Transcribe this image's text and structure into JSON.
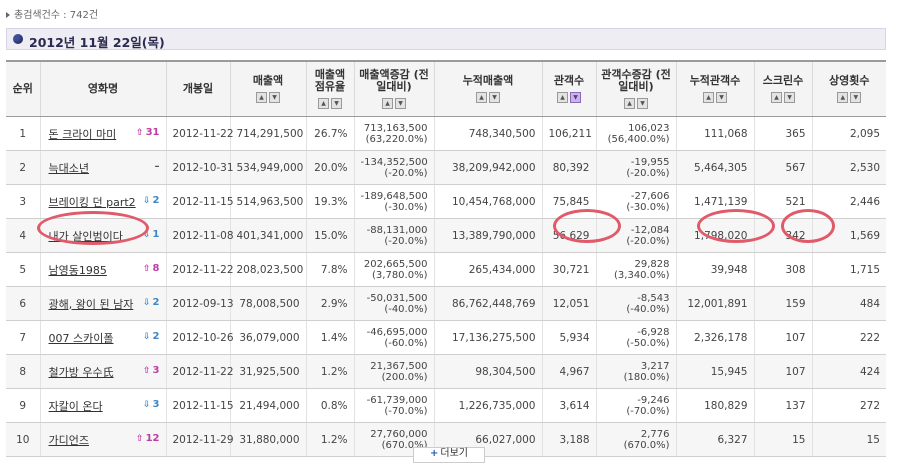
{
  "summary": {
    "total_label": "총검색건수 : 742건"
  },
  "date": {
    "title": "2012년 11월 22일(목)"
  },
  "columns": [
    "순위",
    "영화명",
    "개봉일",
    "매출액",
    "매출액 점유율",
    "매출액증감 (전일대비)",
    "누적매출액",
    "관객수",
    "관객수증감 (전일대비)",
    "누적관객수",
    "스크린수",
    "상영횟수"
  ],
  "rows": [
    {
      "rank": "1",
      "title": "돈 크라이 마미",
      "change": "31",
      "dir": "up",
      "release": "2012-11-22",
      "sales": "714,291,500",
      "share": "26.7%",
      "sales_delta": "713,163,500",
      "sales_delta_pct": "(63,220.0%)",
      "cum_sales": "748,340,500",
      "audience": "106,211",
      "aud_delta": "106,023",
      "aud_delta_pct": "(56,400.0%)",
      "cum_aud": "111,068",
      "screens": "365",
      "shows": "2,095"
    },
    {
      "rank": "2",
      "title": "늑대소년",
      "change": "–",
      "dir": "same",
      "release": "2012-10-31",
      "sales": "534,949,000",
      "share": "20.0%",
      "sales_delta": "-134,352,500",
      "sales_delta_pct": "(-20.0%)",
      "cum_sales": "38,209,942,000",
      "audience": "80,392",
      "aud_delta": "-19,955",
      "aud_delta_pct": "(-20.0%)",
      "cum_aud": "5,464,305",
      "screens": "567",
      "shows": "2,530"
    },
    {
      "rank": "3",
      "title": "브레이킹 던 part2",
      "change": "2",
      "dir": "down",
      "release": "2012-11-15",
      "sales": "514,963,500",
      "share": "19.3%",
      "sales_delta": "-189,648,500",
      "sales_delta_pct": "(-30.0%)",
      "cum_sales": "10,454,768,000",
      "audience": "75,845",
      "aud_delta": "-27,606",
      "aud_delta_pct": "(-30.0%)",
      "cum_aud": "1,471,139",
      "screens": "521",
      "shows": "2,446"
    },
    {
      "rank": "4",
      "title": "내가 살인범이다",
      "change": "1",
      "dir": "down",
      "release": "2012-11-08",
      "sales": "401,341,000",
      "share": "15.0%",
      "sales_delta": "-88,131,000",
      "sales_delta_pct": "(-20.0%)",
      "cum_sales": "13,389,790,000",
      "audience": "56,629",
      "aud_delta": "-12,084",
      "aud_delta_pct": "(-20.0%)",
      "cum_aud": "1,798,020",
      "screens": "342",
      "shows": "1,569"
    },
    {
      "rank": "5",
      "title": "남영동1985",
      "change": "8",
      "dir": "up",
      "release": "2012-11-22",
      "sales": "208,023,500",
      "share": "7.8%",
      "sales_delta": "202,665,500",
      "sales_delta_pct": "(3,780.0%)",
      "cum_sales": "265,434,000",
      "audience": "30,721",
      "aud_delta": "29,828",
      "aud_delta_pct": "(3,340.0%)",
      "cum_aud": "39,948",
      "screens": "308",
      "shows": "1,715"
    },
    {
      "rank": "6",
      "title": "광해, 왕이 된 남자",
      "change": "2",
      "dir": "down",
      "release": "2012-09-13",
      "sales": "78,008,500",
      "share": "2.9%",
      "sales_delta": "-50,031,500",
      "sales_delta_pct": "(-40.0%)",
      "cum_sales": "86,762,448,769",
      "audience": "12,051",
      "aud_delta": "-8,543",
      "aud_delta_pct": "(-40.0%)",
      "cum_aud": "12,001,891",
      "screens": "159",
      "shows": "484"
    },
    {
      "rank": "7",
      "title": "007 스카이폴",
      "change": "2",
      "dir": "down",
      "release": "2012-10-26",
      "sales": "36,079,000",
      "share": "1.4%",
      "sales_delta": "-46,695,000",
      "sales_delta_pct": "(-60.0%)",
      "cum_sales": "17,136,275,500",
      "audience": "5,934",
      "aud_delta": "-6,928",
      "aud_delta_pct": "(-50.0%)",
      "cum_aud": "2,326,178",
      "screens": "107",
      "shows": "222"
    },
    {
      "rank": "8",
      "title": "철가방 우수氏",
      "change": "3",
      "dir": "up",
      "release": "2012-11-22",
      "sales": "31,925,500",
      "share": "1.2%",
      "sales_delta": "21,367,500",
      "sales_delta_pct": "(200.0%)",
      "cum_sales": "98,304,500",
      "audience": "4,967",
      "aud_delta": "3,217",
      "aud_delta_pct": "(180.0%)",
      "cum_aud": "15,945",
      "screens": "107",
      "shows": "424"
    },
    {
      "rank": "9",
      "title": "자칼이 온다",
      "change": "3",
      "dir": "down",
      "release": "2012-11-15",
      "sales": "21,494,000",
      "share": "0.8%",
      "sales_delta": "-61,739,000",
      "sales_delta_pct": "(-70.0%)",
      "cum_sales": "1,226,735,000",
      "audience": "3,614",
      "aud_delta": "-9,246",
      "aud_delta_pct": "(-70.0%)",
      "cum_aud": "180,829",
      "screens": "137",
      "shows": "272"
    },
    {
      "rank": "10",
      "title": "가디언즈",
      "change": "12",
      "dir": "up",
      "release": "2012-11-29",
      "sales": "31,880,000",
      "share": "1.2%",
      "sales_delta": "27,760,000",
      "sales_delta_pct": "(670.0%)",
      "cum_sales": "66,027,000",
      "audience": "3,188",
      "aud_delta": "2,776",
      "aud_delta_pct": "(670.0%)",
      "cum_aud": "6,327",
      "screens": "15",
      "shows": "15"
    }
  ],
  "more_button": {
    "label": "더보기"
  },
  "colors": {
    "up": "#c03ca5",
    "down": "#3f87c8",
    "highlight_circle": "#e05a6a"
  }
}
